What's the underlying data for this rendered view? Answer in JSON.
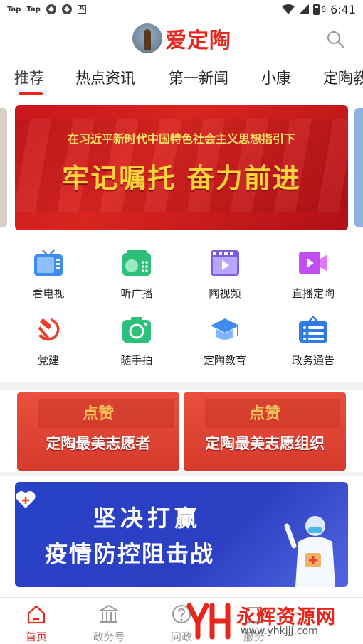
{
  "status_bar": {
    "apps": [
      "Tap",
      "Tap"
    ],
    "time": "6:41",
    "battery_level": "6"
  },
  "header": {
    "app_name": "爱定陶"
  },
  "tabs": [
    {
      "label": "推荐",
      "active": true
    },
    {
      "label": "热点资讯"
    },
    {
      "label": "第一新闻"
    },
    {
      "label": "小康"
    },
    {
      "label": "定陶教"
    }
  ],
  "banner": {
    "subtitle": "在习近平新时代中国特色社会主义思想指引下",
    "title": "牢记嘱托 奋力前进"
  },
  "quick_grid": [
    {
      "label": "看电视",
      "icon": "tv-icon"
    },
    {
      "label": "听广播",
      "icon": "radio-icon"
    },
    {
      "label": "陶视频",
      "icon": "video-icon"
    },
    {
      "label": "直播定陶",
      "icon": "live-camera-icon"
    },
    {
      "label": "党建",
      "icon": "hammer-sickle-icon"
    },
    {
      "label": "随手拍",
      "icon": "camera-icon"
    },
    {
      "label": "定陶教育",
      "icon": "graduation-cap-icon"
    },
    {
      "label": "政务通告",
      "icon": "notice-board-icon"
    }
  ],
  "promos": [
    {
      "tag": "点赞",
      "title": "定陶最美志愿者"
    },
    {
      "tag": "点赞",
      "title": "定陶最美志愿组织"
    }
  ],
  "epidemic_banner": {
    "line1": "坚决打赢",
    "line2": "疫情防控阻击战"
  },
  "bottom_nav": [
    {
      "label": "首页",
      "icon": "home-icon",
      "active": true
    },
    {
      "label": "政务号",
      "icon": "government-icon"
    },
    {
      "label": "问政",
      "icon": "question-icon"
    },
    {
      "label": "服务",
      "icon": "service-icon"
    }
  ],
  "watermark": {
    "text": "永辉资源网",
    "url": "www.yhkjjj.com"
  },
  "colors": {
    "brand_red": "#e8251b",
    "banner_red": "#c8161d",
    "epidemic_blue": "#2842c8"
  }
}
